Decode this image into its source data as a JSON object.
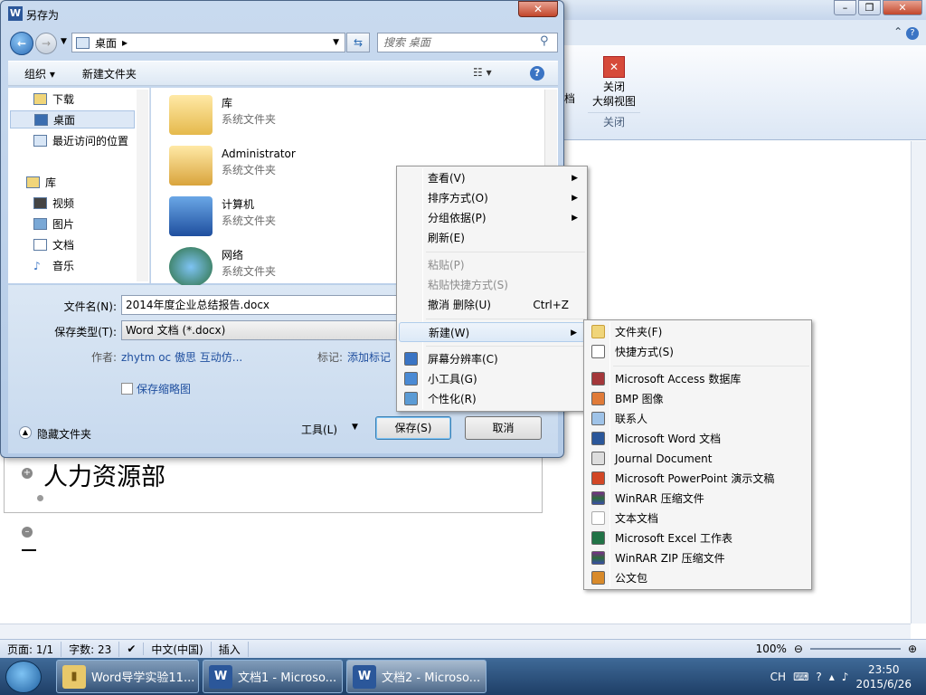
{
  "word": {
    "ribbon_close": "关闭\n大纲视图",
    "ribbon_group": "关闭",
    "ribbon_partial": "档",
    "outline_text": "人力资源部",
    "status": {
      "page": "页面: 1/1",
      "words": "字数: 23",
      "lang": "中文(中国)",
      "mode": "插入",
      "zoom": "100%"
    }
  },
  "dialog": {
    "title": "另存为",
    "address": "桌面",
    "search_placeholder": "搜索 桌面",
    "toolbar": {
      "organize": "组织 ▾",
      "new_folder": "新建文件夹"
    },
    "nav": [
      {
        "label": "下载"
      },
      {
        "label": "桌面"
      },
      {
        "label": "最近访问的位置"
      },
      {
        "label": "库"
      },
      {
        "label": "视频"
      },
      {
        "label": "图片"
      },
      {
        "label": "文档"
      },
      {
        "label": "音乐"
      }
    ],
    "files": [
      {
        "name": "库",
        "type": "系统文件夹"
      },
      {
        "name": "Administrator",
        "type": "系统文件夹"
      },
      {
        "name": "计算机",
        "type": "系统文件夹"
      },
      {
        "name": "网络",
        "type": "系统文件夹"
      }
    ],
    "filename_label": "文件名(N):",
    "filename_value": "2014年度企业总结报告.docx",
    "filetype_label": "保存类型(T):",
    "filetype_value": "Word 文档 (*.docx)",
    "author_label": "作者:",
    "author_value": "zhytm oc 傲思  互动仿...",
    "tags_label": "标记:",
    "tags_value": "添加标记",
    "thumbnail_label": "保存缩略图",
    "hide_folders": "隐藏文件夹",
    "tools": "工具(L)",
    "save": "保存(S)",
    "cancel": "取消"
  },
  "context_menu": {
    "items": [
      {
        "label": "查看(V)"
      },
      {
        "label": "排序方式(O)"
      },
      {
        "label": "分组依据(P)"
      },
      {
        "label": "刷新(E)"
      },
      {
        "label": "粘贴(P)"
      },
      {
        "label": "粘贴快捷方式(S)"
      },
      {
        "label": "撤消 删除(U)",
        "shortcut": "Ctrl+Z"
      },
      {
        "label": "新建(W)"
      },
      {
        "label": "屏幕分辨率(C)"
      },
      {
        "label": "小工具(G)"
      },
      {
        "label": "个性化(R)"
      }
    ]
  },
  "new_submenu": {
    "items": [
      {
        "label": "文件夹(F)"
      },
      {
        "label": "快捷方式(S)"
      },
      {
        "label": "Microsoft Access 数据库"
      },
      {
        "label": "BMP 图像"
      },
      {
        "label": "联系人"
      },
      {
        "label": "Microsoft Word 文档"
      },
      {
        "label": "Journal Document"
      },
      {
        "label": "Microsoft PowerPoint 演示文稿"
      },
      {
        "label": "WinRAR 压缩文件"
      },
      {
        "label": "文本文档"
      },
      {
        "label": "Microsoft Excel 工作表"
      },
      {
        "label": "WinRAR ZIP 压缩文件"
      },
      {
        "label": "公文包"
      }
    ]
  },
  "taskbar": {
    "items": [
      {
        "label": "Word导学实验11..."
      },
      {
        "label": "文档1 - Microso..."
      },
      {
        "label": "文档2 - Microso..."
      }
    ],
    "tray_lang": "CH",
    "time": "23:50",
    "date": "2015/6/26"
  }
}
